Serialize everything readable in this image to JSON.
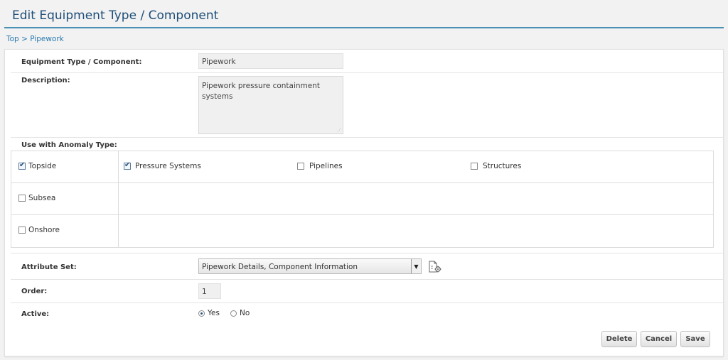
{
  "page": {
    "title": "Edit Equipment Type / Component"
  },
  "breadcrumb": {
    "top": "Top",
    "current": "> Pipework"
  },
  "form": {
    "equipment_label": "Equipment Type / Component:",
    "equipment_value": "Pipework",
    "description_label": "Description:",
    "description_value": "Pipework pressure containment systems",
    "anomaly_label": "Use with Anomaly Type:",
    "anomaly_types": [
      {
        "label": "Topside",
        "checked": true
      },
      {
        "label": "Subsea",
        "checked": false
      },
      {
        "label": "Onshore",
        "checked": false
      }
    ],
    "topside_options": [
      {
        "label": "Pressure Systems",
        "checked": true
      },
      {
        "label": "Pipelines",
        "checked": false
      },
      {
        "label": "Structures",
        "checked": false
      }
    ],
    "attribute_set_label": "Attribute Set:",
    "attribute_set_value": "Pipework Details, Component Information",
    "order_label": "Order:",
    "order_value": "1",
    "active_label": "Active:",
    "active_options": [
      {
        "label": "Yes",
        "selected": true
      },
      {
        "label": "No",
        "selected": false
      }
    ]
  },
  "buttons": {
    "delete": "Delete",
    "cancel": "Cancel",
    "save": "Save"
  },
  "icons": {
    "attribute_config": "document-gear-icon",
    "select_arrow": "chevron-down-icon",
    "resize": "resize-grip-icon"
  },
  "colors": {
    "title": "#1e4e79",
    "rule": "#4a8fb4",
    "link": "#2a7ab0"
  }
}
